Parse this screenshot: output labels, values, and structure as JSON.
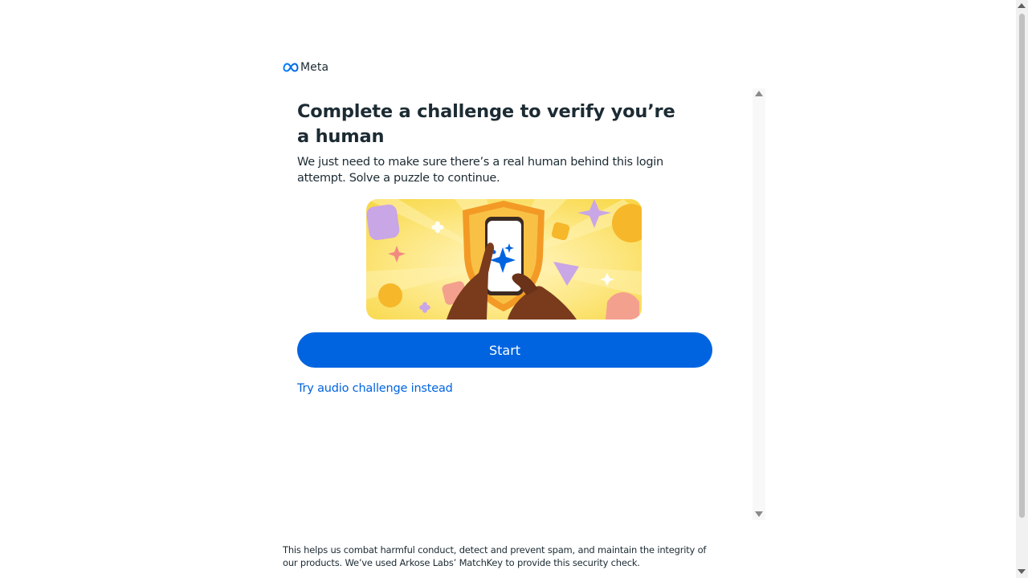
{
  "brand": {
    "name": "Meta",
    "logo_icon": "meta-infinity-logo",
    "color": "#0064e0"
  },
  "challenge": {
    "title": "Complete a challenge to verify you’re a human",
    "subtitle": "We just need to make sure there’s a real human behind this login attempt. Solve a puzzle to continue.",
    "illustration": "hands-holding-phone-shield-illustration",
    "start_label": "Start",
    "audio_link_label": "Try audio challenge instead"
  },
  "footer": {
    "text": "This helps us combat harmful conduct, detect and prevent spam, and maintain the integrity of our products. We’ve used Arkose Labs’ MatchKey to provide this security check."
  },
  "colors": {
    "primary_button": "#0064e0",
    "link": "#0064e0",
    "text": "#1c2b33",
    "illustration_bg": "#fbe46a"
  }
}
